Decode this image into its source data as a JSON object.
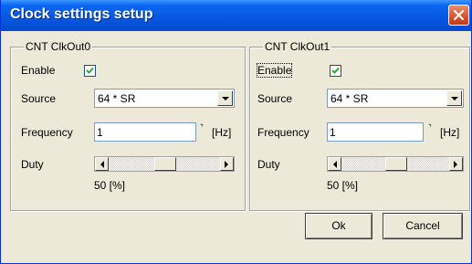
{
  "window": {
    "title": "Clock settings setup"
  },
  "groups": [
    {
      "legend": "CNT ClkOut0",
      "enable_label": "Enable",
      "enable_checked": true,
      "source_label": "Source",
      "source_value": "64 * SR",
      "frequency_label": "Frequency",
      "frequency_value": "1",
      "frequency_unit": "[Hz]",
      "duty_label": "Duty",
      "duty_value": "50 [%]",
      "duty_percent": 50
    },
    {
      "legend": "CNT ClkOut1",
      "enable_label": "Enable",
      "enable_checked": true,
      "source_label": "Source",
      "source_value": "64 * SR",
      "frequency_label": "Frequency",
      "frequency_value": "1",
      "frequency_unit": "[Hz]",
      "duty_label": "Duty",
      "duty_value": "50 [%]",
      "duty_percent": 50
    }
  ],
  "buttons": {
    "ok": "Ok",
    "cancel": "Cancel"
  },
  "icons": {
    "close": "close-icon",
    "checkmark": "checkmark-icon",
    "dropdown": "chevron-down-icon",
    "scroll_left": "arrow-left-icon",
    "scroll_right": "arrow-right-icon",
    "spin": "spin-arrows-icon"
  }
}
